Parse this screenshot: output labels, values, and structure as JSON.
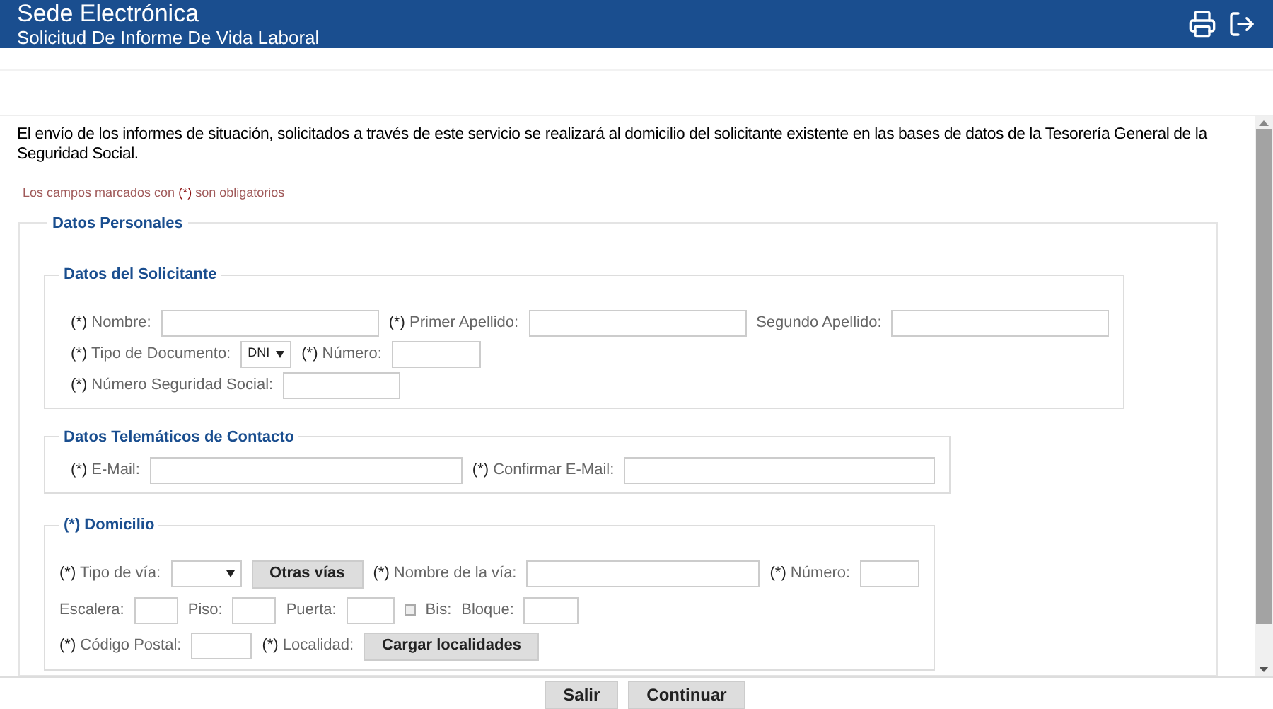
{
  "header": {
    "title": "Sede Electrónica",
    "subtitle": "Solicitud De Informe De Vida Laboral"
  },
  "intro": "El envío de los informes de situación, solicitados a través de este servicio se realizará al domicilio del solicitante existente en las bases de datos de la Tesorería General de la Seguridad Social.",
  "required_note": {
    "before": "Los campos marcados con",
    "mark": "(*)",
    "after": "son obligatorios"
  },
  "form": {
    "title": "Datos Personales",
    "sections": [
      {
        "title": "Datos del Solicitante",
        "rows": [
          [
            {
              "kind": "label",
              "mark": "(*)",
              "text": "Nombre:"
            },
            {
              "kind": "input"
            },
            {
              "kind": "label",
              "mark": "(*)",
              "text": "Primer Apellido:"
            },
            {
              "kind": "input"
            },
            {
              "kind": "label",
              "text": "Segundo Apellido:"
            },
            {
              "kind": "input"
            }
          ],
          [
            {
              "kind": "label",
              "mark": "(*)",
              "text": "Tipo de Documento:"
            },
            {
              "kind": "select",
              "value": "DNI"
            },
            {
              "kind": "label",
              "mark": "(*)",
              "text": "Número:"
            },
            {
              "kind": "input"
            }
          ],
          [
            {
              "kind": "label",
              "mark": "(*)",
              "text": "Número Seguridad Social:"
            },
            {
              "kind": "input"
            }
          ]
        ]
      },
      {
        "title": "Datos Telemáticos de Contacto",
        "rows": [
          [
            {
              "kind": "label",
              "mark": "(*)",
              "text": "E-Mail:"
            },
            {
              "kind": "input"
            },
            {
              "kind": "label",
              "mark": "(*)",
              "text": "Confirmar E-Mail:"
            },
            {
              "kind": "input"
            }
          ]
        ]
      },
      {
        "title": "(*) Domicilio",
        "rows": [
          [
            {
              "kind": "label",
              "mark": "(*)",
              "text": "Tipo de vía:"
            },
            {
              "kind": "select"
            },
            {
              "kind": "button",
              "text": "Otras vías"
            },
            {
              "kind": "label",
              "mark": "(*)",
              "text": "Nombre de la vía:"
            },
            {
              "kind": "input"
            },
            {
              "kind": "label",
              "mark": "(*)",
              "text": "Número:"
            },
            {
              "kind": "input"
            }
          ],
          [
            {
              "kind": "label",
              "text": "Escalera:"
            },
            {
              "kind": "input"
            },
            {
              "kind": "label",
              "text": "Piso:"
            },
            {
              "kind": "input"
            },
            {
              "kind": "label",
              "text": "Puerta:"
            },
            {
              "kind": "input"
            },
            {
              "kind": "checkbox",
              "checked": false
            },
            {
              "kind": "label",
              "text": "Bis:"
            },
            {
              "kind": "label",
              "text": "Bloque:"
            },
            {
              "kind": "input"
            }
          ],
          [
            {
              "kind": "label",
              "mark": "(*)",
              "text": "Código Postal:"
            },
            {
              "kind": "input"
            },
            {
              "kind": "label",
              "mark": "(*)",
              "text": "Localidad:"
            },
            {
              "kind": "button",
              "text": "Cargar localidades"
            }
          ]
        ]
      }
    ]
  },
  "buttons": [
    {
      "text": "Salir"
    },
    {
      "text": "Continuar"
    }
  ]
}
